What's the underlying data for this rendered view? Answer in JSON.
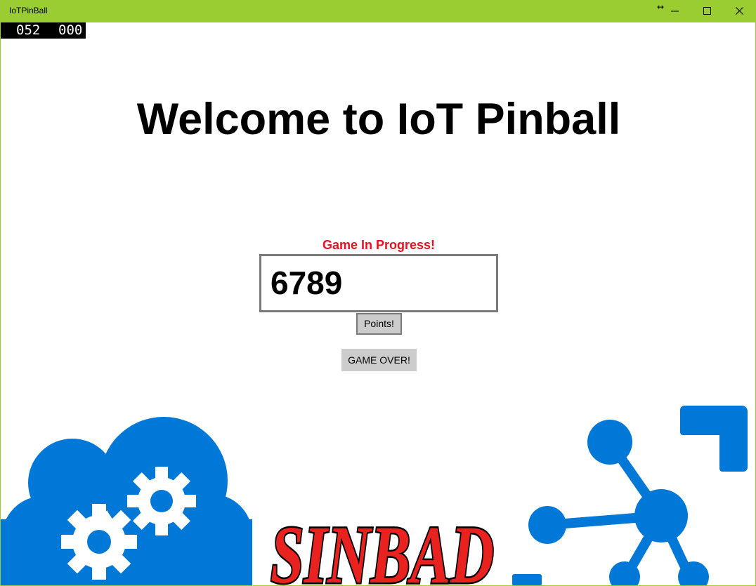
{
  "window": {
    "title": "IoTPinBall",
    "resize_glyph": "↔",
    "accent_color": "#9acd32"
  },
  "counter": {
    "left_value": "052",
    "right_value": "000"
  },
  "main": {
    "heading": "Welcome to IoT Pinball",
    "status": "Game In Progress!",
    "score": "6789",
    "points_label": "Points!",
    "game_over_label": "GAME OVER!"
  },
  "art": {
    "sinbad_text": "SINBAD",
    "icons": [
      "cloud-gears-icon",
      "sinbad-logo",
      "network-icon"
    ],
    "icon_color": "#0078d7",
    "logo_color": "#e8231f"
  }
}
